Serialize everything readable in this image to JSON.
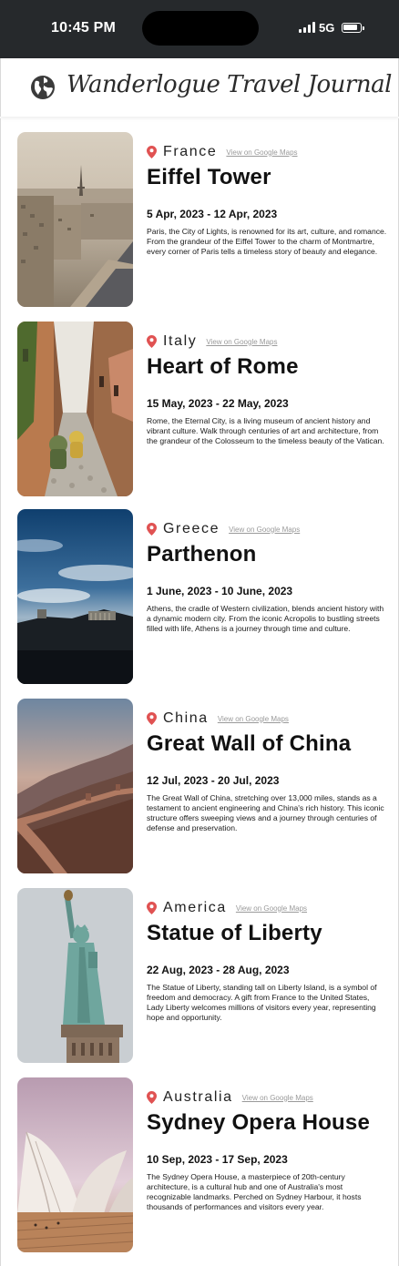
{
  "status": {
    "time": "10:45 PM",
    "network": "5G"
  },
  "header": {
    "title": "Wanderlogue Travel Journal",
    "icon": "globe-icon"
  },
  "entries": [
    {
      "country": "France",
      "maps_link": "View on Google Maps",
      "title": "Eiffel Tower",
      "dates": "5 Apr, 2023 - 12 Apr, 2023",
      "description": "Paris, the City of Lights, is renowned for its art, culture, and romance. From the grandeur of the Eiffel Tower to the charm of Montmartre, every corner of Paris tells a timeless story of beauty and elegance."
    },
    {
      "country": "Italy",
      "maps_link": "View on Google Maps",
      "title": "Heart of Rome",
      "dates": "15 May, 2023 - 22 May, 2023",
      "description": "Rome, the Eternal City, is a living museum of ancient history and vibrant culture. Walk through centuries of art and architecture, from the grandeur of the Colosseum to the timeless beauty of the Vatican."
    },
    {
      "country": "Greece",
      "maps_link": "View on Google Maps",
      "title": "Parthenon",
      "dates": "1 June, 2023 - 10 June, 2023",
      "description": "Athens, the cradle of Western civilization, blends ancient history with a dynamic modern city. From the iconic Acropolis to bustling streets filled with life, Athens is a journey through time and culture."
    },
    {
      "country": "China",
      "maps_link": "View on Google Maps",
      "title": "Great Wall of China",
      "dates": "12 Jul, 2023 - 20 Jul, 2023",
      "description": "The Great Wall of China, stretching over 13,000 miles, stands as a testament to ancient engineering and China's rich history. This iconic structure offers sweeping views and a journey through centuries of defense and preservation."
    },
    {
      "country": "America",
      "maps_link": "View on Google Maps",
      "title": "Statue of Liberty",
      "dates": "22 Aug, 2023 - 28 Aug, 2023",
      "description": "The Statue of Liberty, standing tall on Liberty Island, is a symbol of freedom and democracy. A gift from France to the United States, Lady Liberty welcomes millions of visitors every year, representing hope and opportunity."
    },
    {
      "country": "Australia",
      "maps_link": "View on Google Maps",
      "title": "Sydney Opera House",
      "dates": "10 Sep, 2023 - 17 Sep, 2023",
      "description": "The Sydney Opera House, a masterpiece of 20th-century architecture, is a cultural hub and one of Australia's most recognizable landmarks. Perched on Sydney Harbour, it hosts thousands of performances and visitors every year."
    }
  ],
  "colors": {
    "pin": "#e05252",
    "status_bar": "#26292c"
  }
}
